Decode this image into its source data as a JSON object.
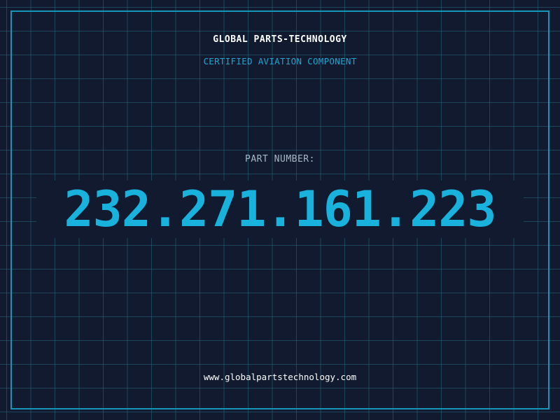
{
  "header": {
    "company_name": "GLOBAL PARTS-TECHNOLOGY",
    "tagline": "CERTIFIED AVIATION COMPONENT"
  },
  "part": {
    "label": "PART NUMBER:",
    "number": "232.271.161.223"
  },
  "footer": {
    "website": "www.globalpartstechnology.com"
  },
  "colors": {
    "background": "#111a2e",
    "grid": "#246880",
    "border": "#1595b8",
    "accent": "#18b2dc",
    "text": "#ffffff"
  }
}
